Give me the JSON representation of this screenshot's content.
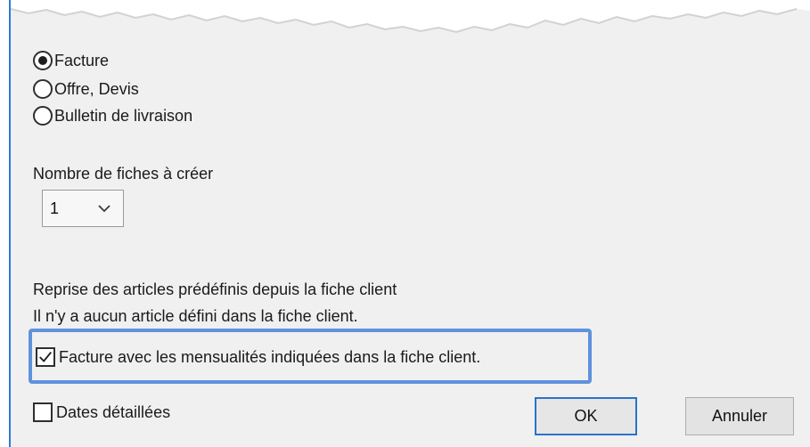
{
  "document_type": {
    "options": [
      {
        "label": "Facture",
        "checked": true
      },
      {
        "label": "Offre, Devis",
        "checked": false
      },
      {
        "label": "Bulletin de livraison",
        "checked": false
      }
    ]
  },
  "quantity": {
    "label": "Nombre de fiches à créer",
    "selected_value": "1"
  },
  "articles": {
    "title": "Reprise des articles prédéfinis depuis la fiche client",
    "message": "Il n'y a aucun article défini dans la fiche client."
  },
  "monthly_payments_checkbox": {
    "label": "Facture avec les mensualités indiquées dans la fiche client.",
    "checked": true
  },
  "detailed_dates_checkbox": {
    "label": "Dates détaillées",
    "checked": false
  },
  "buttons": {
    "ok_label": "OK",
    "cancel_label": "Annuler"
  },
  "colors": {
    "dialog_background": "#f0f0f0",
    "accent_blue": "#2b73c7",
    "highlight_blue": "#5f92dd"
  }
}
